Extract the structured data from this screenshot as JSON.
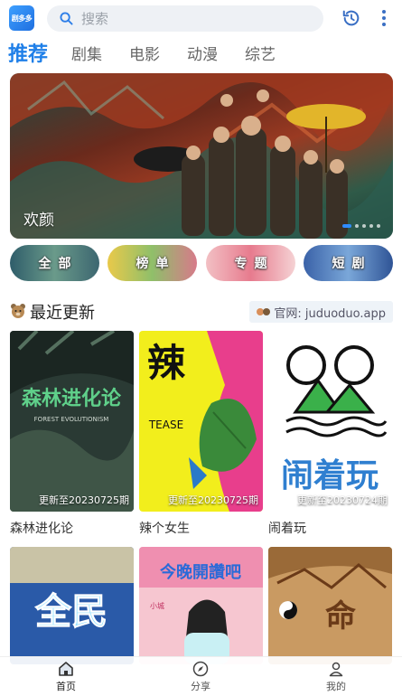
{
  "app": {
    "logo_text": "剧多多"
  },
  "search": {
    "placeholder": "搜索"
  },
  "tabs": [
    {
      "label": "推荐",
      "active": true
    },
    {
      "label": "剧集"
    },
    {
      "label": "电影"
    },
    {
      "label": "动漫"
    },
    {
      "label": "综艺"
    }
  ],
  "banner": {
    "title": "欢颜",
    "dots": 5,
    "active_dot": 0
  },
  "chips": [
    {
      "label": "全部"
    },
    {
      "label": "榜单"
    },
    {
      "label": "专题"
    },
    {
      "label": "短剧"
    }
  ],
  "section": {
    "title": "最近更新",
    "site_label": "官网: juduoduo.app"
  },
  "cards": [
    {
      "title": "森林进化论",
      "update": "更新至20230725期",
      "poster_text": "森林进化论",
      "poster_subtext": "FOREST EVOLUTIONISM"
    },
    {
      "title": "辣个女生",
      "update": "更新至20230725期",
      "poster_text": "辣",
      "poster_subtext": "TEASE"
    },
    {
      "title": "闹着玩",
      "update": "更新至20230724期",
      "poster_text": "闹着玩"
    },
    {
      "title": "",
      "update": "",
      "poster_text": "全民"
    },
    {
      "title": "",
      "update": "",
      "poster_text": "今晚開讚吧",
      "poster_subtext": "小城"
    },
    {
      "title": "",
      "update": "",
      "poster_text": "命"
    }
  ],
  "bottom_nav": [
    {
      "label": "首页",
      "icon": "home-icon",
      "active": true
    },
    {
      "label": "分享",
      "icon": "compass-icon"
    },
    {
      "label": "我的",
      "icon": "user-icon"
    }
  ],
  "colors": {
    "accent": "#1f7fe8",
    "banner_dot": "#2f8cff"
  }
}
